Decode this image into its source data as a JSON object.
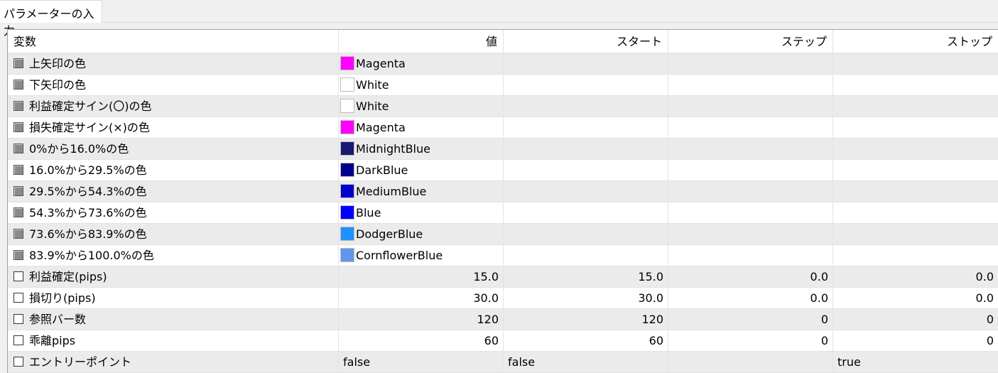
{
  "tab": {
    "label": "パラメーターの入力"
  },
  "columns": {
    "name": "変数",
    "value": "値",
    "start": "スタート",
    "step": "ステップ",
    "stop": "ストップ"
  },
  "rows": [
    {
      "name": "上矢印の色",
      "value": "Magenta",
      "swatch": "#ff00ff",
      "start": "",
      "step": "",
      "stop": "",
      "checkbox": "grey"
    },
    {
      "name": "下矢印の色",
      "value": "White",
      "swatch": "#ffffff",
      "start": "",
      "step": "",
      "stop": "",
      "checkbox": "grey"
    },
    {
      "name": "利益確定サイン(〇)の色",
      "value": "White",
      "swatch": "#ffffff",
      "start": "",
      "step": "",
      "stop": "",
      "checkbox": "grey"
    },
    {
      "name": "損失確定サイン(×)の色",
      "value": "Magenta",
      "swatch": "#ff00ff",
      "start": "",
      "step": "",
      "stop": "",
      "checkbox": "grey"
    },
    {
      "name": "0%から16.0%の色",
      "value": "MidnightBlue",
      "swatch": "#191970",
      "start": "",
      "step": "",
      "stop": "",
      "checkbox": "grey"
    },
    {
      "name": "16.0%から29.5%の色",
      "value": "DarkBlue",
      "swatch": "#00008b",
      "start": "",
      "step": "",
      "stop": "",
      "checkbox": "grey"
    },
    {
      "name": "29.5%から54.3%の色",
      "value": "MediumBlue",
      "swatch": "#0000cd",
      "start": "",
      "step": "",
      "stop": "",
      "checkbox": "grey"
    },
    {
      "name": "54.3%から73.6%の色",
      "value": "Blue",
      "swatch": "#0000ff",
      "start": "",
      "step": "",
      "stop": "",
      "checkbox": "grey"
    },
    {
      "name": "73.6%から83.9%の色",
      "value": "DodgerBlue",
      "swatch": "#1e90ff",
      "start": "",
      "step": "",
      "stop": "",
      "checkbox": "grey"
    },
    {
      "name": "83.9%から100.0%の色",
      "value": "CornflowerBlue",
      "swatch": "#6495ed",
      "start": "",
      "step": "",
      "stop": "",
      "checkbox": "grey"
    },
    {
      "name": "利益確定(pips)",
      "value": "15.0",
      "start": "15.0",
      "step": "0.0",
      "stop": "0.0",
      "checkbox": "white",
      "align": "num"
    },
    {
      "name": "損切り(pips)",
      "value": "30.0",
      "start": "30.0",
      "step": "0.0",
      "stop": "0.0",
      "checkbox": "white",
      "align": "num"
    },
    {
      "name": "参照バー数",
      "value": "120",
      "start": "120",
      "step": "0",
      "stop": "0",
      "checkbox": "white",
      "align": "num"
    },
    {
      "name": "乖離pips",
      "value": "60",
      "start": "60",
      "step": "0",
      "stop": "0",
      "checkbox": "white",
      "align": "num"
    },
    {
      "name": "エントリーポイント",
      "value": "false",
      "start": "false",
      "step": "",
      "stop": "true",
      "checkbox": "white",
      "align": "txt"
    }
  ]
}
